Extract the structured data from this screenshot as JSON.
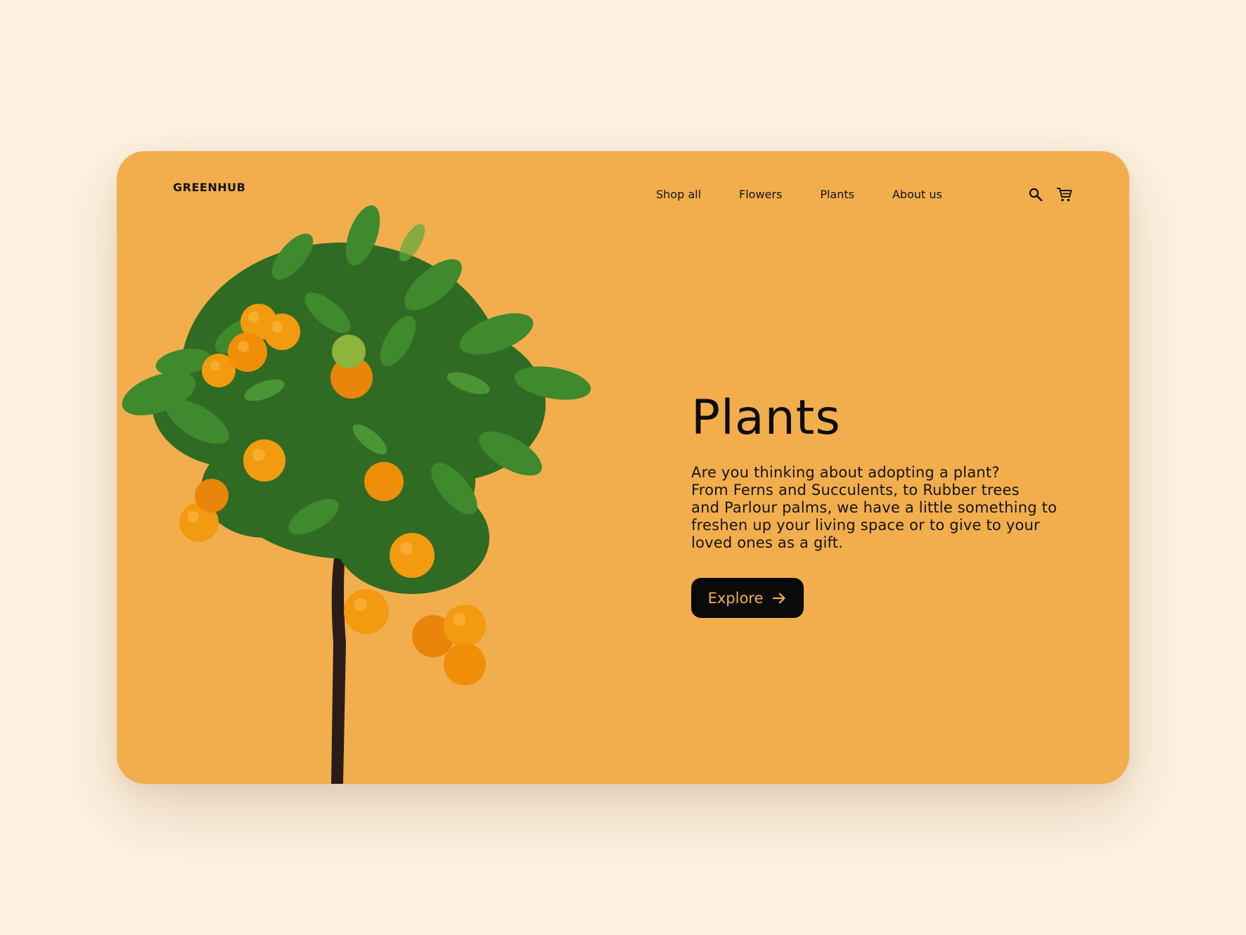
{
  "brand": {
    "name": "GREENHUB"
  },
  "nav": {
    "items": [
      {
        "label": "Shop all"
      },
      {
        "label": "Flowers"
      },
      {
        "label": "Plants"
      },
      {
        "label": "About us"
      }
    ]
  },
  "icons": {
    "search": "search-icon",
    "cart": "cart-icon",
    "arrow": "arrow-right-icon"
  },
  "hero": {
    "title": "Plants",
    "description_lines": [
      "Are you thinking about adopting a plant?",
      "From Ferns and Succulents, to Rubber trees",
      "and Parlour palms, we have a little something to",
      "freshen up your living space or to give to your",
      "loved ones as a gift."
    ],
    "cta_label": "Explore"
  },
  "image": {
    "subject": "orange-tree"
  },
  "colors": {
    "page_background": "#fdf1e1",
    "card_background": "#f2ae4d",
    "text": "#141414",
    "button_background": "#0a0a0a",
    "button_text": "#f2ae4d"
  }
}
